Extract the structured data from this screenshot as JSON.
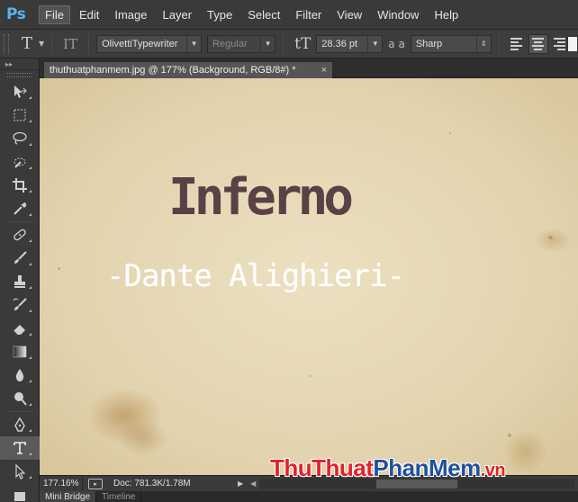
{
  "app": {
    "logo": "Ps"
  },
  "menu": [
    {
      "label": "File",
      "active": true
    },
    {
      "label": "Edit"
    },
    {
      "label": "Image"
    },
    {
      "label": "Layer"
    },
    {
      "label": "Type"
    },
    {
      "label": "Select"
    },
    {
      "label": "Filter"
    },
    {
      "label": "View"
    },
    {
      "label": "Window"
    },
    {
      "label": "Help"
    }
  ],
  "options": {
    "tool_glyph": "T",
    "orient_glyph": "IT",
    "font_family": "OlivettiTypewriter",
    "font_style": "Regular",
    "size_glyph": "tT",
    "font_size": "28.36 pt",
    "aa_glyph": "a a",
    "anti_alias": "Sharp",
    "alignments": [
      "left-align",
      "center-align",
      "right-align"
    ]
  },
  "document": {
    "tab_title": "thuthuatphanmem.jpg @ 177% (Background, RGB/8#) *",
    "close_glyph": "×",
    "title_text": "Inferno",
    "subtitle_text": "-Dante Alighieri-"
  },
  "status": {
    "zoom": "177.16%",
    "doc_info": "Doc: 781.3K/1.78M"
  },
  "bottom_tabs": [
    "Mini Bridge",
    "Timeline"
  ],
  "watermark": {
    "part1": "ThuThuat",
    "part2": "PhanMem",
    "part3": ".vn"
  },
  "colors": {
    "title_text": "#5a4145",
    "subtitle_text": "#ffffff",
    "ps_blue": "#5cb1f0"
  }
}
